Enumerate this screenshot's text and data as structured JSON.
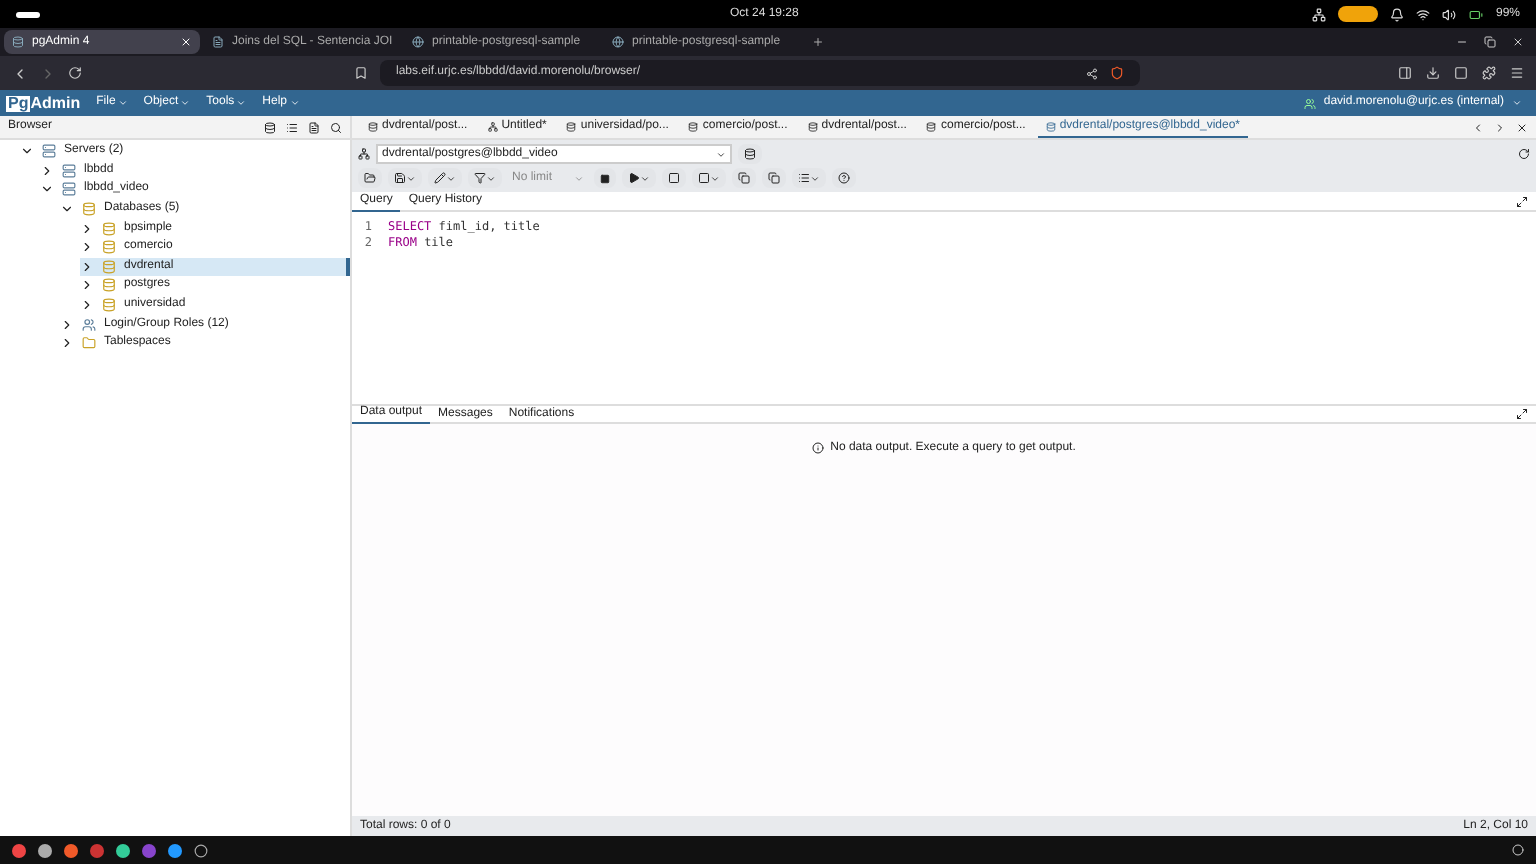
{
  "system_bar": {
    "clock": "Oct 24  19:28",
    "battery": "99%"
  },
  "browser_tabs": [
    {
      "title": "pgAdmin 4",
      "selected": true,
      "kind": "app"
    },
    {
      "title": "Joins del SQL - Sentencia JOI",
      "selected": false,
      "kind": "doc"
    },
    {
      "title": "printable-postgresql-sample",
      "selected": false,
      "kind": "web"
    },
    {
      "title": "printable-postgresql-sample",
      "selected": false,
      "kind": "web"
    }
  ],
  "address_bar": {
    "url": "labs.eif.urjc.es/lbbdd/david.morenolu/browser/"
  },
  "app": {
    "logo_prefix": "Pg",
    "logo_suffix": "Admin",
    "menus": [
      "File",
      "Object",
      "Tools",
      "Help"
    ],
    "user": "david.morenolu@urjc.es (internal)"
  },
  "browser_panel": {
    "title": "Browser",
    "tree": [
      {
        "label": "Servers (2)",
        "kind": "servers",
        "expanded": true,
        "selected": false,
        "children": [
          {
            "label": "lbbdd",
            "kind": "server",
            "expanded": false,
            "selected": false
          },
          {
            "label": "lbbdd_video",
            "kind": "server",
            "expanded": true,
            "selected": false,
            "children": [
              {
                "label": "Databases (5)",
                "kind": "database",
                "expanded": true,
                "selected": false,
                "children": [
                  {
                    "label": "bpsimple",
                    "kind": "database",
                    "expanded": false,
                    "selected": false
                  },
                  {
                    "label": "comercio",
                    "kind": "database",
                    "expanded": false,
                    "selected": false
                  },
                  {
                    "label": "dvdrental",
                    "kind": "database",
                    "expanded": false,
                    "selected": true
                  },
                  {
                    "label": "postgres",
                    "kind": "database",
                    "expanded": false,
                    "selected": false
                  },
                  {
                    "label": "universidad",
                    "kind": "database",
                    "expanded": false,
                    "selected": false
                  }
                ]
              },
              {
                "label": "Login/Group Roles (12)",
                "kind": "roles",
                "expanded": false,
                "selected": false
              },
              {
                "label": "Tablespaces",
                "kind": "folder",
                "expanded": false,
                "selected": false
              }
            ]
          }
        ]
      }
    ]
  },
  "editor_tabs": [
    {
      "title": "dvdrental/post...",
      "kind": "query",
      "selected": false
    },
    {
      "title": "Untitled*",
      "kind": "erd",
      "selected": false
    },
    {
      "title": "universidad/po...",
      "kind": "query",
      "selected": false
    },
    {
      "title": "comercio/post...",
      "kind": "query",
      "selected": false
    },
    {
      "title": "dvdrental/post...",
      "kind": "query",
      "selected": false
    },
    {
      "title": "comercio/post...",
      "kind": "query",
      "selected": false
    },
    {
      "title": "dvdrental/postgres@lbbdd_video*",
      "kind": "query",
      "selected": true
    }
  ],
  "connection": {
    "value": "dvdrental/postgres@lbbdd_video"
  },
  "toolbar": {
    "limit": "No limit"
  },
  "query_tabs": [
    {
      "label": "Query",
      "selected": true
    },
    {
      "label": "Query History",
      "selected": false
    }
  ],
  "code_lines": [
    {
      "number": "1",
      "tokens": [
        {
          "text": "SELECT",
          "kind": "keyword"
        },
        {
          "text": " fiml_id, title",
          "kind": "plain"
        }
      ]
    },
    {
      "number": "2",
      "tokens": [
        {
          "text": "FROM",
          "kind": "keyword"
        },
        {
          "text": " tile",
          "kind": "plain"
        }
      ]
    }
  ],
  "output_tabs": [
    {
      "label": "Data output",
      "selected": true
    },
    {
      "label": "Messages",
      "selected": false
    },
    {
      "label": "Notifications",
      "selected": false
    }
  ],
  "output_message": "No data output. Execute a query to get output.",
  "status_bar": {
    "rows": "Total rows: 0 of 0",
    "cursor": "Ln 2, Col 10"
  }
}
